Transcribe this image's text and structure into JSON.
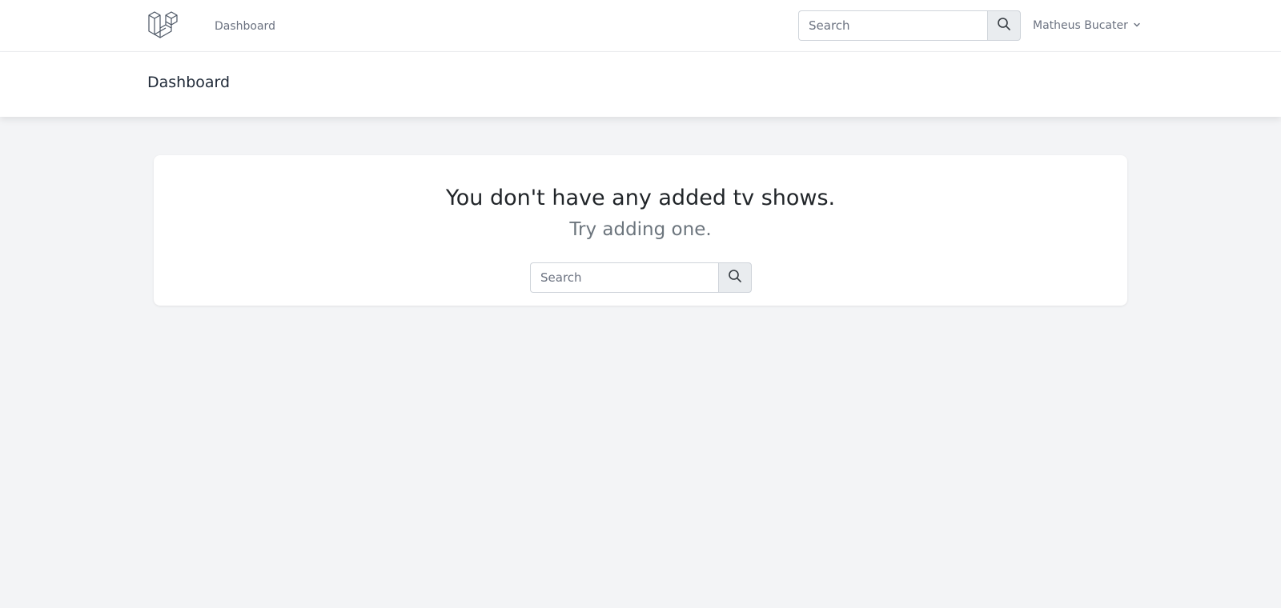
{
  "nav": {
    "logo_icon": "laravel-logo-icon",
    "dashboard_link": "Dashboard",
    "search": {
      "placeholder": "Search",
      "value": "",
      "button_icon": "search-icon"
    },
    "user_name": "Matheus Bucater",
    "user_menu_icon": "chevron-down-icon"
  },
  "header": {
    "title": "Dashboard"
  },
  "main": {
    "empty_heading": "You don't have any added tv shows.",
    "empty_subheading": "Try adding one.",
    "search": {
      "placeholder": "Search",
      "value": "",
      "button_icon": "search-icon"
    }
  },
  "colors": {
    "background": "#f3f4f6",
    "surface": "#ffffff",
    "muted_text": "#6b7280",
    "button_bg": "#e9ecef"
  }
}
